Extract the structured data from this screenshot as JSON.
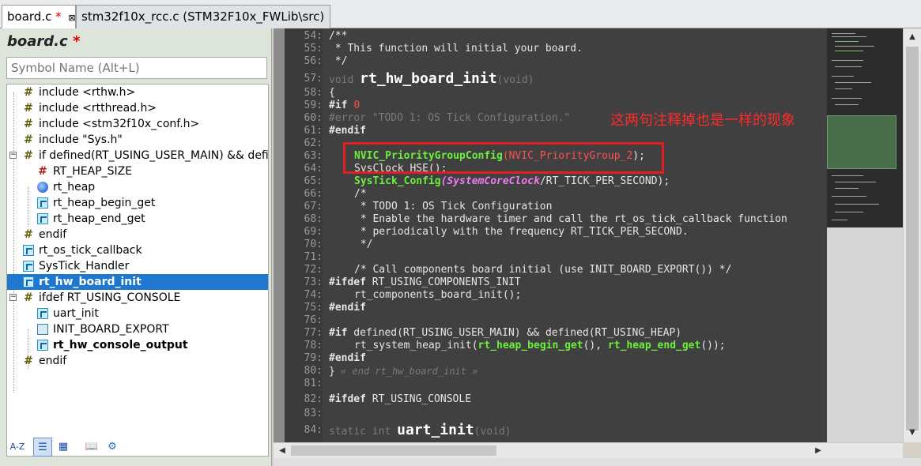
{
  "tabs": [
    {
      "label": "board.c",
      "modified_mark": "*",
      "close": "⊠"
    },
    {
      "label": "stm32f10x_rcc.c (STM32F10x_FWLib\\src)"
    }
  ],
  "left_panel": {
    "file_title": "board.c",
    "modified_mark": "*",
    "search_placeholder": "Symbol Name (Alt+L)",
    "tree": [
      {
        "label": "include <rthw.h>",
        "icon": "hash-icon"
      },
      {
        "label": "include <rtthread.h>",
        "icon": "hash-icon"
      },
      {
        "label": "include <stm32f10x_conf.h>",
        "icon": "hash-icon"
      },
      {
        "label": "include \"Sys.h\"",
        "icon": "hash-icon"
      },
      {
        "label": "if defined(RT_USING_USER_MAIN) && defin",
        "icon": "hash-icon"
      },
      {
        "label": "RT_HEAP_SIZE",
        "icon": "define-icon"
      },
      {
        "label": "rt_heap",
        "icon": "variable-icon"
      },
      {
        "label": "rt_heap_begin_get",
        "icon": "function-icon"
      },
      {
        "label": "rt_heap_end_get",
        "icon": "function-icon"
      },
      {
        "label": "endif",
        "icon": "hash-icon"
      },
      {
        "label": "rt_os_tick_callback",
        "icon": "function-icon"
      },
      {
        "label": "SysTick_Handler",
        "icon": "function-icon"
      },
      {
        "label": "rt_hw_board_init",
        "icon": "function-icon"
      },
      {
        "label": "ifdef RT_USING_CONSOLE",
        "icon": "hash-icon"
      },
      {
        "label": "uart_init",
        "icon": "function-icon"
      },
      {
        "label": "INIT_BOARD_EXPORT",
        "icon": "macro-icon"
      },
      {
        "label": "rt_hw_console_output",
        "icon": "function-icon"
      },
      {
        "label": "endif",
        "icon": "hash-icon"
      }
    ],
    "toolbar": {
      "sort_label": "A-Z"
    }
  },
  "code": {
    "line_numbers": [
      "54:",
      "55:",
      "56:",
      "57:",
      "58:",
      "59:",
      "60:",
      "61:",
      "62:",
      "63:",
      "64:",
      "65:",
      "66:",
      "67:",
      "68:",
      "69:",
      "70:",
      "71:",
      "72:",
      "73:",
      "74:",
      "75:",
      "76:",
      "77:",
      "78:",
      "79:",
      "80:",
      "81:",
      "82:",
      "83:",
      "84:"
    ],
    "l54": "/**",
    "l55": " * This function will initial your board.",
    "l56": " */",
    "l57_kw": "void",
    "l57_fn": "rt_hw_board_init",
    "l57_args": "(void)",
    "l58": "{",
    "l59_kw": "#if",
    "l59_val": "0",
    "l60": "#error \"TODO 1: OS Tick Configuration.\"",
    "l61": "#endif",
    "l62": "",
    "l63_fn": "NVIC_PriorityGroupConfig",
    "l63_paren": "(",
    "l63_arg": "NVIC_PriorityGroup_2",
    "l63_end": ");",
    "l64": "SysClock_HSE();",
    "l65_fn": "SysTick_Config",
    "l65_paren": "(",
    "l65_arg": "SystemCoreClock",
    "l65_end": "/RT_TICK_PER_SECOND);",
    "l66": "/*",
    "l67": " * TODO 1: OS Tick Configuration",
    "l68": " * Enable the hardware timer and call the rt_os_tick_callback function",
    "l69": " * periodically with the frequency RT_TICK_PER_SECOND.",
    "l70": " */",
    "l71": "",
    "l72": "/* Call components board initial (use INIT_BOARD_EXPORT()) */",
    "l73_kw": "#ifdef",
    "l73_rest": " RT_USING_COMPONENTS_INIT",
    "l74": "rt_components_board_init();",
    "l75": "#endif",
    "l76": "",
    "l77_kw": "#if",
    "l77_rest": " defined(RT_USING_USER_MAIN) && defined(RT_USING_HEAP)",
    "l78_a": "rt_system_heap_init(",
    "l78_b": "rt_heap_begin_get",
    "l78_c": "(), ",
    "l78_d": "rt_heap_end_get",
    "l78_e": "());",
    "l79": "#endif",
    "l80_brace": "}",
    "l80_note": " « end rt_hw_board_init »",
    "l81": "",
    "l82_kw": "#ifdef",
    "l82_rest": " RT_USING_CONSOLE",
    "l83": "",
    "l84_kw": "static int",
    "l84_fn": "uart_init",
    "l84_args": "(void)"
  },
  "annotation": {
    "text": "这两句注释掉也是一样的现象",
    "color": "#e02020"
  },
  "scroll_arrows": {
    "up": "▲",
    "down": "▼",
    "left": "◀",
    "right": "▶"
  }
}
